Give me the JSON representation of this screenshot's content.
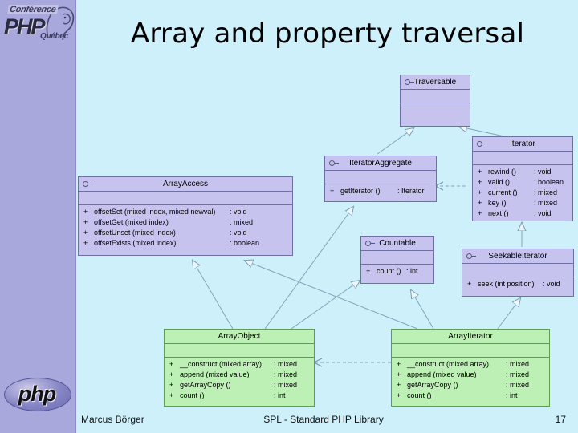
{
  "slide": {
    "title": "Array and property traversal",
    "background_color": "#cdf0fb",
    "sidebar_color": "#a9a8dd"
  },
  "logo": {
    "conference": "Conférence",
    "php": "PHP",
    "quebec": "Québec",
    "bottom_word": "php"
  },
  "footer": {
    "author": "Marcus Börger",
    "center": "SPL - Standard PHP Library",
    "page": "17"
  },
  "diagram": {
    "interface_color": "#c6c3ef",
    "class_color": "#bdf0b5",
    "classes": [
      {
        "id": "traversable",
        "name": "Traversable",
        "stereotype": "interface",
        "operations": []
      },
      {
        "id": "iterator",
        "name": "Iterator",
        "stereotype": "interface",
        "operations": [
          {
            "vis": "+",
            "sig": "rewind ()",
            "type": ": void"
          },
          {
            "vis": "+",
            "sig": "valid ()",
            "type": ": boolean"
          },
          {
            "vis": "+",
            "sig": "current ()",
            "type": ": mixed"
          },
          {
            "vis": "+",
            "sig": "key ()",
            "type": ": mixed"
          },
          {
            "vis": "+",
            "sig": "next ()",
            "type": ": void"
          }
        ]
      },
      {
        "id": "iteratoraggregate",
        "name": "IteratorAggregate",
        "stereotype": "interface",
        "operations": [
          {
            "vis": "+",
            "sig": "getIterator ()",
            "type": ": Iterator"
          }
        ]
      },
      {
        "id": "arrayaccess",
        "name": "ArrayAccess",
        "stereotype": "interface",
        "operations": [
          {
            "vis": "+",
            "sig": "offsetSet (mixed index, mixed newval)",
            "type": ": void"
          },
          {
            "vis": "+",
            "sig": "offsetGet (mixed index)",
            "type": ": mixed"
          },
          {
            "vis": "+",
            "sig": "offsetUnset (mixed index)",
            "type": ": void"
          },
          {
            "vis": "+",
            "sig": "offsetExists (mixed index)",
            "type": ": boolean"
          }
        ]
      },
      {
        "id": "countable",
        "name": "Countable",
        "stereotype": "interface",
        "operations": [
          {
            "vis": "+",
            "sig": "count ()",
            "type": ": int"
          }
        ]
      },
      {
        "id": "seekableiterator",
        "name": "SeekableIterator",
        "stereotype": "interface",
        "operations": [
          {
            "vis": "+",
            "sig": "seek (int position)",
            "type": ": void"
          }
        ]
      },
      {
        "id": "arrayobject",
        "name": "ArrayObject",
        "stereotype": "class",
        "operations": [
          {
            "vis": "+",
            "sig": "__construct (mixed array)",
            "type": ": mixed"
          },
          {
            "vis": "+",
            "sig": "append (mixed value)",
            "type": ": mixed"
          },
          {
            "vis": "+",
            "sig": "getArrayCopy ()",
            "type": ": mixed"
          },
          {
            "vis": "+",
            "sig": "count ()",
            "type": ": int"
          }
        ]
      },
      {
        "id": "arrayiterator",
        "name": "ArrayIterator",
        "stereotype": "class",
        "operations": [
          {
            "vis": "+",
            "sig": "__construct (mixed array)",
            "type": ": mixed"
          },
          {
            "vis": "+",
            "sig": "append (mixed value)",
            "type": ": mixed"
          },
          {
            "vis": "+",
            "sig": "getArrayCopy ()",
            "type": ": mixed"
          },
          {
            "vis": "+",
            "sig": "count ()",
            "type": ": int"
          }
        ]
      }
    ],
    "relations": [
      {
        "from": "iteratoraggregate",
        "to": "traversable",
        "kind": "generalization"
      },
      {
        "from": "iterator",
        "to": "traversable",
        "kind": "generalization"
      },
      {
        "from": "seekableiterator",
        "to": "iterator",
        "kind": "generalization"
      },
      {
        "from": "arrayobject",
        "to": "arrayaccess",
        "kind": "realization"
      },
      {
        "from": "arrayobject",
        "to": "iteratoraggregate",
        "kind": "realization"
      },
      {
        "from": "arrayobject",
        "to": "countable",
        "kind": "realization"
      },
      {
        "from": "arrayiterator",
        "to": "arrayaccess",
        "kind": "realization"
      },
      {
        "from": "arrayiterator",
        "to": "countable",
        "kind": "realization"
      },
      {
        "from": "arrayiterator",
        "to": "seekableiterator",
        "kind": "realization"
      },
      {
        "from": "iterator",
        "to": "iteratoraggregate",
        "kind": "dependency"
      },
      {
        "from": "arrayiterator",
        "to": "arrayobject",
        "kind": "dependency"
      }
    ]
  }
}
